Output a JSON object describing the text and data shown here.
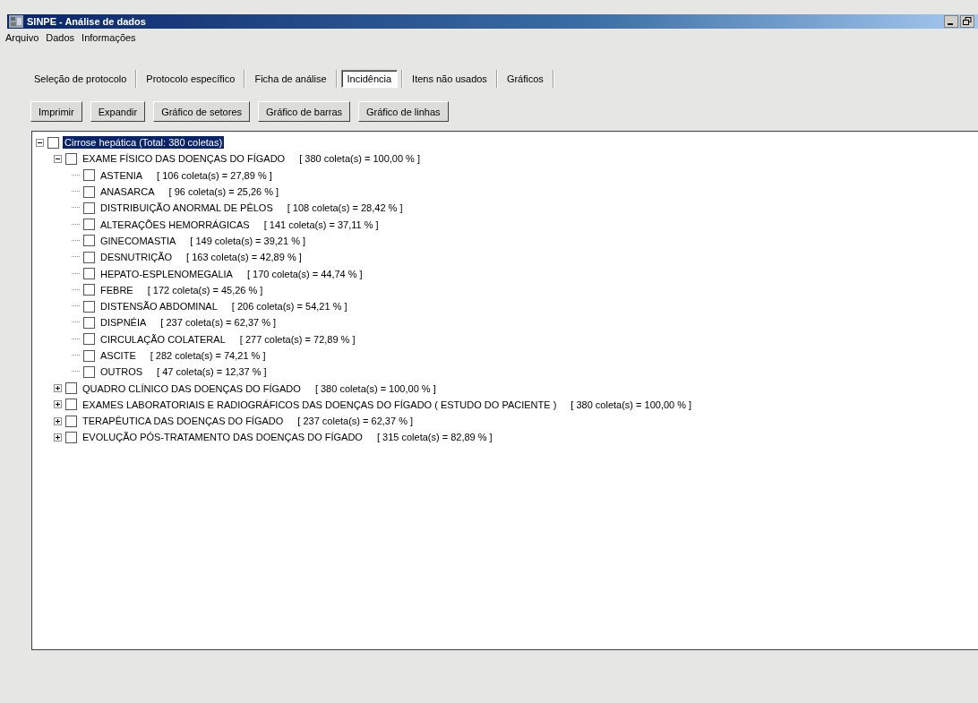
{
  "window": {
    "title": "SINPE - Análise de dados"
  },
  "menu": [
    "Arquivo",
    "Dados",
    "Informações"
  ],
  "tabs": [
    {
      "label": "Seleção de protocolo",
      "selected": false
    },
    {
      "label": "Protocolo específico",
      "selected": false
    },
    {
      "label": "Ficha de análise",
      "selected": false
    },
    {
      "label": "Incidência",
      "selected": true
    },
    {
      "label": "Itens não usados",
      "selected": false
    },
    {
      "label": "Gráficos",
      "selected": false
    }
  ],
  "buttons": [
    "Imprimir",
    "Expandir",
    "Gráfico de setores",
    "Gráfico de barras",
    "Gráfico de linhas"
  ],
  "tree": {
    "nodes": [
      {
        "label": "Cirrose hepática (Total: 380 coletas)",
        "checked": false,
        "selected": true,
        "expanded": true,
        "children": [
          {
            "label": "EXAME FÍSICO DAS DOENÇAS DO FÍGADO",
            "count": "[ 380 coleta(s) = 100,00 % ]",
            "checked": false,
            "selected": false,
            "expanded": true,
            "children": [
              {
                "label": "ASTENIA",
                "count": "[ 106 coleta(s) = 27,89 % ]",
                "checked": false,
                "selected": false
              },
              {
                "label": "ANASARCA",
                "count": "[ 96 coleta(s) = 25,26 % ]",
                "checked": false,
                "selected": false
              },
              {
                "label": "DISTRIBUIÇÃO ANORMAL DE PÊLOS",
                "count": "[ 108 coleta(s) = 28,42 % ]",
                "checked": false,
                "selected": false
              },
              {
                "label": "ALTERAÇÕES HEMORRÁGICAS",
                "count": "[ 141 coleta(s) = 37,11 % ]",
                "checked": false,
                "selected": false
              },
              {
                "label": "GINECOMASTIA",
                "count": "[ 149 coleta(s) = 39,21 % ]",
                "checked": false,
                "selected": false
              },
              {
                "label": "DESNUTRIÇÃO",
                "count": "[ 163 coleta(s) = 42,89 % ]",
                "checked": false,
                "selected": false
              },
              {
                "label": "HEPATO-ESPLENOMEGALIA",
                "count": "[ 170 coleta(s) = 44,74 % ]",
                "checked": false,
                "selected": false
              },
              {
                "label": "FEBRE",
                "count": "[ 172 coleta(s) = 45,26 % ]",
                "checked": false,
                "selected": false
              },
              {
                "label": "DISTENSÃO ABDOMINAL",
                "count": "[ 206 coleta(s) = 54,21 % ]",
                "checked": false,
                "selected": false
              },
              {
                "label": "DISPNÉIA",
                "count": "[ 237 coleta(s) = 62,37 % ]",
                "checked": false,
                "selected": false
              },
              {
                "label": "CIRCULAÇÃO COLATERAL",
                "count": "[ 277 coleta(s) = 72,89 % ]",
                "checked": false,
                "selected": false
              },
              {
                "label": "ASCITE",
                "count": "[ 282 coleta(s) = 74,21 % ]",
                "checked": false,
                "selected": false
              },
              {
                "label": "OUTROS",
                "count": "[ 47 coleta(s) = 12,37 % ]",
                "checked": false,
                "selected": false
              }
            ]
          },
          {
            "label": "QUADRO CLÍNICO DAS DOENÇAS DO FÍGADO",
            "count": "[ 380 coleta(s) = 100,00 % ]",
            "checked": false,
            "selected": false,
            "expanded": false
          },
          {
            "label": "EXAMES LABORATORIAIS E RADIOGRÁFICOS DAS DOENÇAS DO FÍGADO ( ESTUDO DO PACIENTE )",
            "count": "[ 380 coleta(s) = 100,00 % ]",
            "checked": false,
            "selected": false,
            "expanded": false
          },
          {
            "label": "TERAPÊUTICA DAS DOENÇAS DO FÍGADO",
            "count": "[ 237 coleta(s) = 62,37 % ]",
            "checked": false,
            "selected": false,
            "expanded": false
          },
          {
            "label": "EVOLUÇÃO PÓS-TRATAMENTO DAS DOENÇAS DO FÍGADO",
            "count": "[ 315 coleta(s) = 82,89 % ]",
            "checked": false,
            "selected": false,
            "expanded": false
          }
        ]
      }
    ]
  }
}
